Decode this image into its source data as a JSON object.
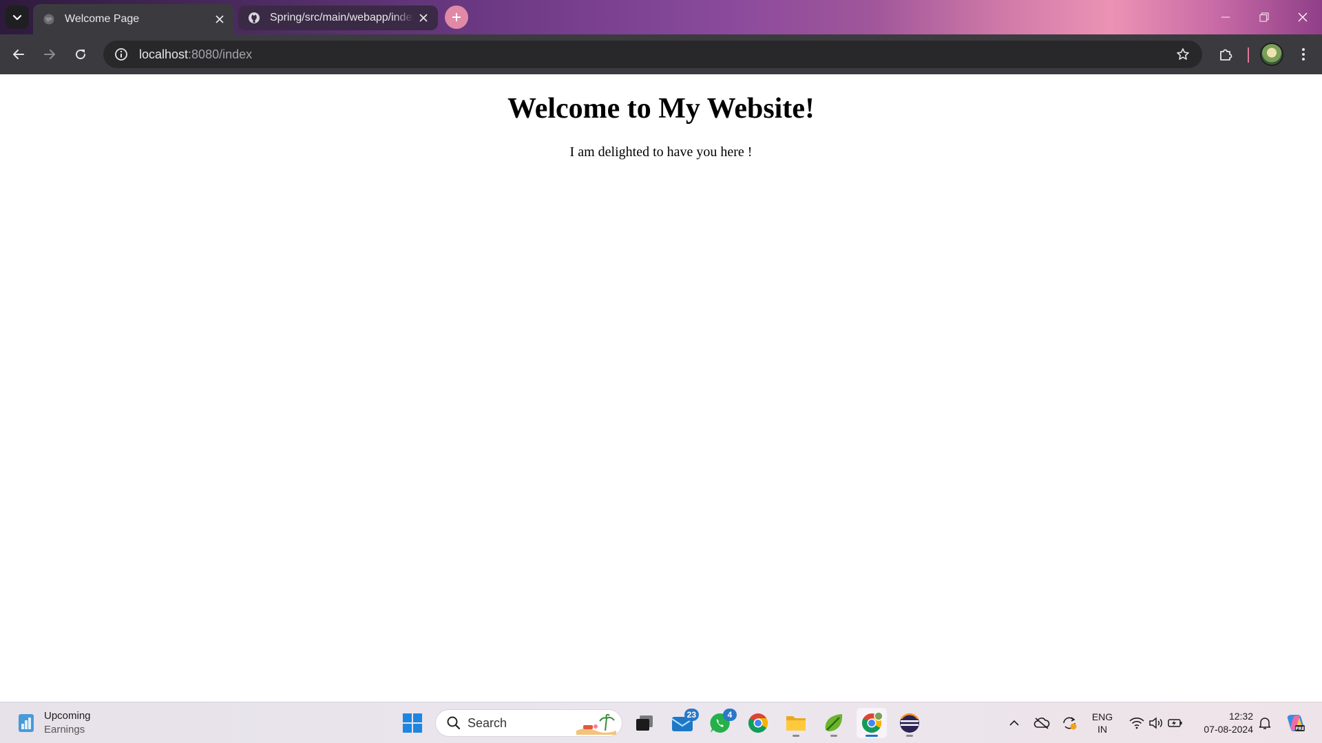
{
  "browser": {
    "tabs": [
      {
        "title": "Welcome Page",
        "active": true,
        "favicon": "globe-icon"
      },
      {
        "title": "Spring/src/main/webapp/index.jsp",
        "active": false,
        "favicon": "github-icon"
      }
    ],
    "address": {
      "host": "localhost",
      "rest": ":8080/index"
    },
    "toolbar_icons": [
      "back-icon",
      "forward-icon",
      "reload-icon",
      "site-info-icon",
      "bookmark-star-icon",
      "extensions-icon",
      "profile-avatar",
      "menu-icon"
    ],
    "window_controls": [
      "minimize-icon",
      "restore-icon",
      "close-icon"
    ]
  },
  "page": {
    "heading": "Welcome to My Website!",
    "paragraph": "I am delighted to have you here !"
  },
  "taskbar": {
    "widget": {
      "title": "Upcoming",
      "subtitle": "Earnings"
    },
    "search_label": "Search",
    "apps": [
      {
        "name": "start-icon"
      },
      {
        "name": "task-view-icon"
      },
      {
        "name": "mail-icon",
        "badge": "23"
      },
      {
        "name": "whatsapp-icon",
        "badge": "4"
      },
      {
        "name": "chrome-icon"
      },
      {
        "name": "file-explorer-icon",
        "running": true
      },
      {
        "name": "spring-tool-suite-icon",
        "running": true
      },
      {
        "name": "chrome-profile-icon",
        "running": true,
        "active": true
      },
      {
        "name": "eclipse-icon",
        "running": true
      }
    ],
    "tray": {
      "lang_line1": "ENG",
      "lang_line2": "IN",
      "time": "12:32",
      "date": "07-08-2024"
    }
  },
  "colors": {
    "tab_active": "#3b3b3f",
    "toolbar": "#3b3b3f",
    "omnibox": "#28282b",
    "page_bg": "#ffffff",
    "taskbar_bg": "#ebe6ee",
    "accent_blue": "#1a73c8"
  }
}
